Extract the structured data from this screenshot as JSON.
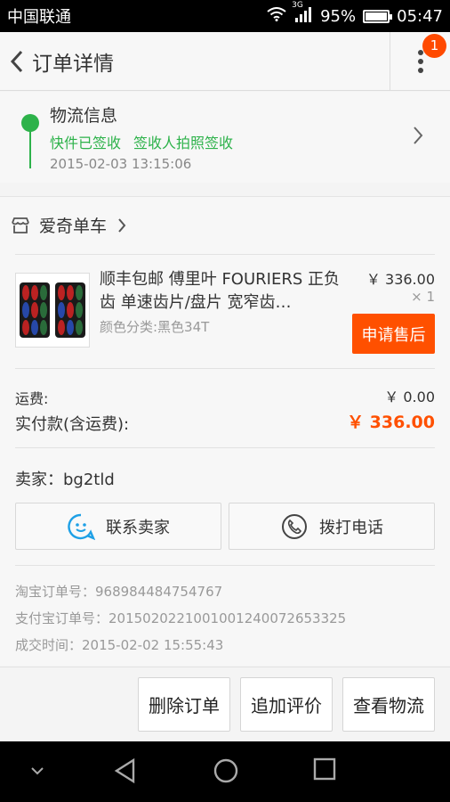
{
  "status_bar": {
    "carrier": "中国联通",
    "network": "3G",
    "battery": "95%",
    "time": "05:47"
  },
  "header": {
    "title": "订单详情",
    "badge_count": "1"
  },
  "logistics": {
    "title": "物流信息",
    "status": "快件已签收",
    "detail": "签收人拍照签收",
    "time": "2015-02-03 13:15:06"
  },
  "shop": {
    "name": "爱奇单车"
  },
  "product": {
    "name": "顺丰包邮 傅里叶 FOURIERS 正负齿 单速齿片/盘片 宽窄齿…",
    "attributes": "颜色分类:黑色34T",
    "price": "￥ 336.00",
    "quantity": "× 1",
    "after_sale_label": "申请售后"
  },
  "totals": {
    "shipping_label": "运费:",
    "shipping_value": "￥ 0.00",
    "paid_label": "实付款(含运费):",
    "paid_value": "￥ 336.00"
  },
  "seller": {
    "text": "卖家：bg2tld"
  },
  "actions": {
    "contact": "联系卖家",
    "call": "拨打电话"
  },
  "order_info": {
    "taobao_no": "淘宝订单号：968984484754767",
    "alipay_no": "支付宝订单号：2015020221001001240072653325",
    "deal_time": "成交时间：2015-02-02 15:55:43"
  },
  "bottom_buttons": [
    "删除订单",
    "追加评价",
    "查看物流"
  ],
  "colors": {
    "accent": "#ff5000",
    "green": "#2db24a",
    "badge": "#ff4a00"
  }
}
